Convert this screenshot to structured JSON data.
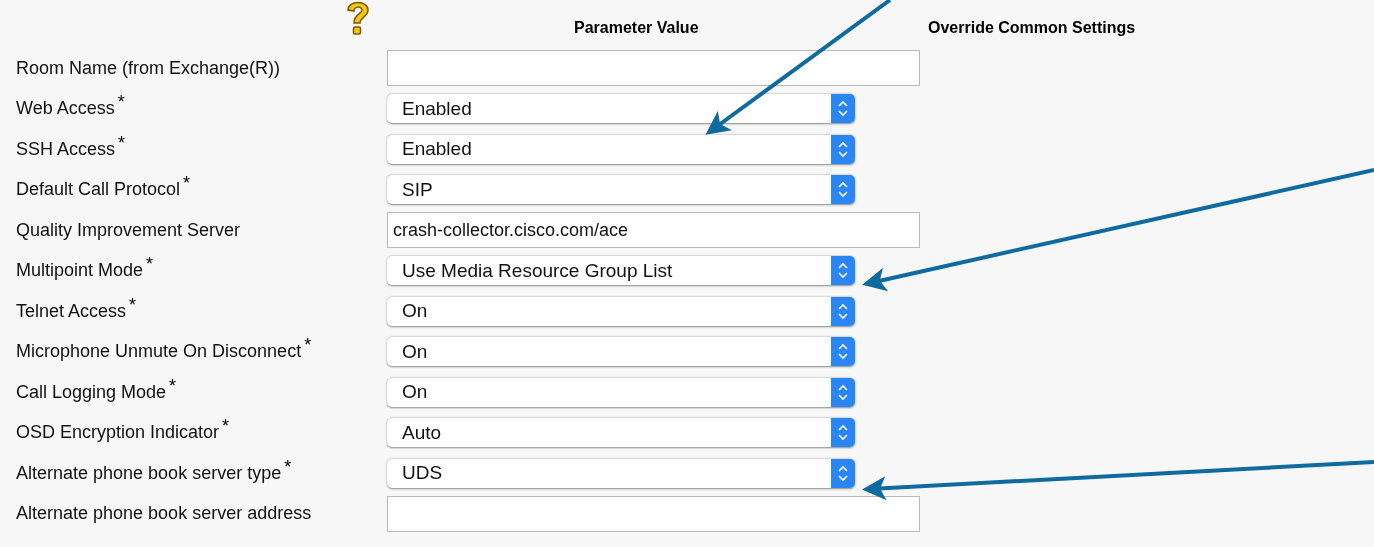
{
  "headers": {
    "parameter_value": "Parameter Value",
    "override": "Override Common Settings"
  },
  "rows": [
    {
      "label": "Room Name (from Exchange(R))",
      "kind": "text",
      "value": ""
    },
    {
      "label": "Web Access",
      "required_mark": "*",
      "kind": "select",
      "value": "Enabled"
    },
    {
      "label": "SSH Access",
      "required_mark": "*",
      "kind": "select",
      "value": "Enabled"
    },
    {
      "label": "Default Call Protocol",
      "required_mark": "*",
      "kind": "select",
      "value": "SIP"
    },
    {
      "label": "Quality Improvement Server",
      "kind": "text",
      "value": "crash-collector.cisco.com/ace"
    },
    {
      "label": "Multipoint Mode",
      "required_mark": "*",
      "kind": "select",
      "value": "Use Media Resource Group List"
    },
    {
      "label": "Telnet Access",
      "required_mark": "*",
      "kind": "select",
      "value": "On"
    },
    {
      "label": "Microphone Unmute On Disconnect",
      "required_mark": "*",
      "kind": "select",
      "value": "On"
    },
    {
      "label": "Call Logging Mode",
      "required_mark": "*",
      "kind": "select",
      "value": "On"
    },
    {
      "label": "OSD Encryption Indicator",
      "required_mark": "*",
      "kind": "select",
      "value": "Auto"
    },
    {
      "label": "Alternate phone book server type",
      "required_mark": "*",
      "kind": "select",
      "value": "UDS"
    },
    {
      "label": "Alternate phone book server address",
      "kind": "text",
      "value": ""
    }
  ]
}
